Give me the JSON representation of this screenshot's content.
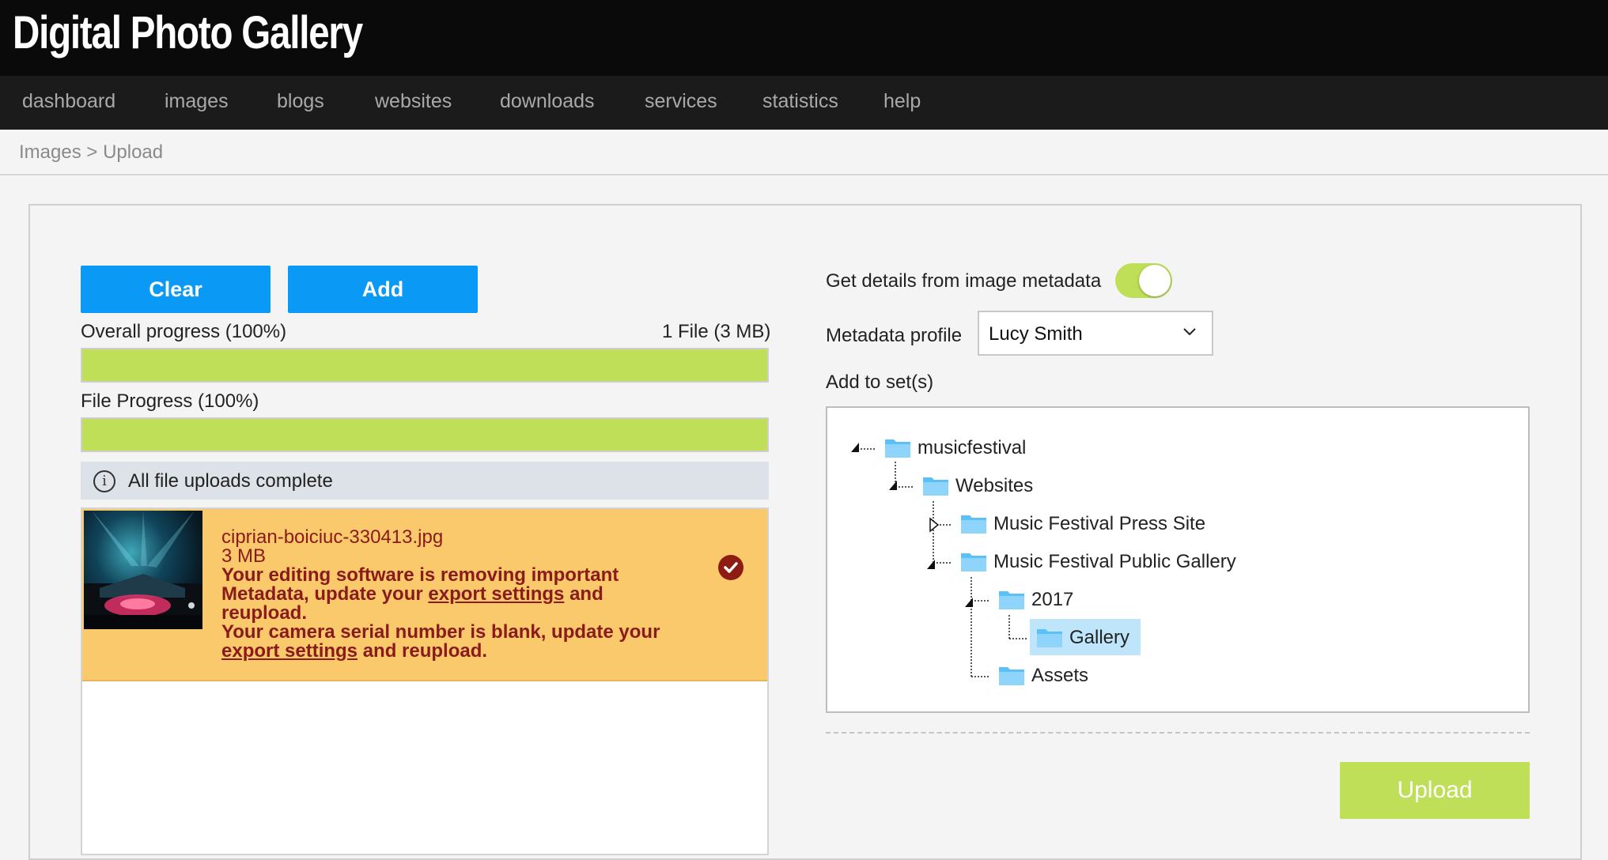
{
  "app": {
    "title": "Digital Photo Gallery"
  },
  "nav": {
    "items": [
      {
        "label": "dashboard"
      },
      {
        "label": "images"
      },
      {
        "label": "blogs"
      },
      {
        "label": "websites"
      },
      {
        "label": "downloads"
      },
      {
        "label": "services"
      },
      {
        "label": "statistics"
      },
      {
        "label": "help"
      }
    ]
  },
  "breadcrumb": {
    "parent": "Images",
    "separator": ">",
    "current": "Upload"
  },
  "upload": {
    "clear_label": "Clear",
    "add_label": "Add",
    "overall_progress_label": "Overall progress (100%)",
    "overall_progress_fraction": 1.0,
    "file_count_label": "1 File (3 MB)",
    "file_progress_label": "File Progress (100%)",
    "file_progress_fraction": 1.0,
    "status_message": "All file uploads complete",
    "files": [
      {
        "name": "ciprian-boiciuc-330413.jpg",
        "size": "3 MB",
        "warning1_pre": "Your editing software is removing important Metadata, update your ",
        "warning1_link": "export settings",
        "warning1_post": " and reupload.",
        "warning2_pre": "Your camera serial number is blank, update your ",
        "warning2_link": "export settings",
        "warning2_post": " and reupload."
      }
    ]
  },
  "metadata": {
    "toggle_label": "Get details from image metadata",
    "toggle_on": true,
    "profile_label": "Metadata profile",
    "profile_value": "Lucy Smith",
    "sets_label": "Add to set(s)"
  },
  "tree": {
    "nodes": [
      {
        "label": "musicfestival"
      },
      {
        "label": "Websites"
      },
      {
        "label": "Music Festival Press Site"
      },
      {
        "label": "Music Festival Public Gallery"
      },
      {
        "label": "2017"
      },
      {
        "label": "Gallery",
        "selected": true
      },
      {
        "label": "Assets"
      }
    ]
  },
  "actions": {
    "upload_label": "Upload"
  },
  "colors": {
    "accent_blue": "#0a9af5",
    "progress_green": "#bedf57",
    "warning_bg": "#f9c96b",
    "warning_text": "#8b1a1a",
    "folder_blue": "#5bc0f5",
    "selected_bg": "#bfe5fb"
  }
}
